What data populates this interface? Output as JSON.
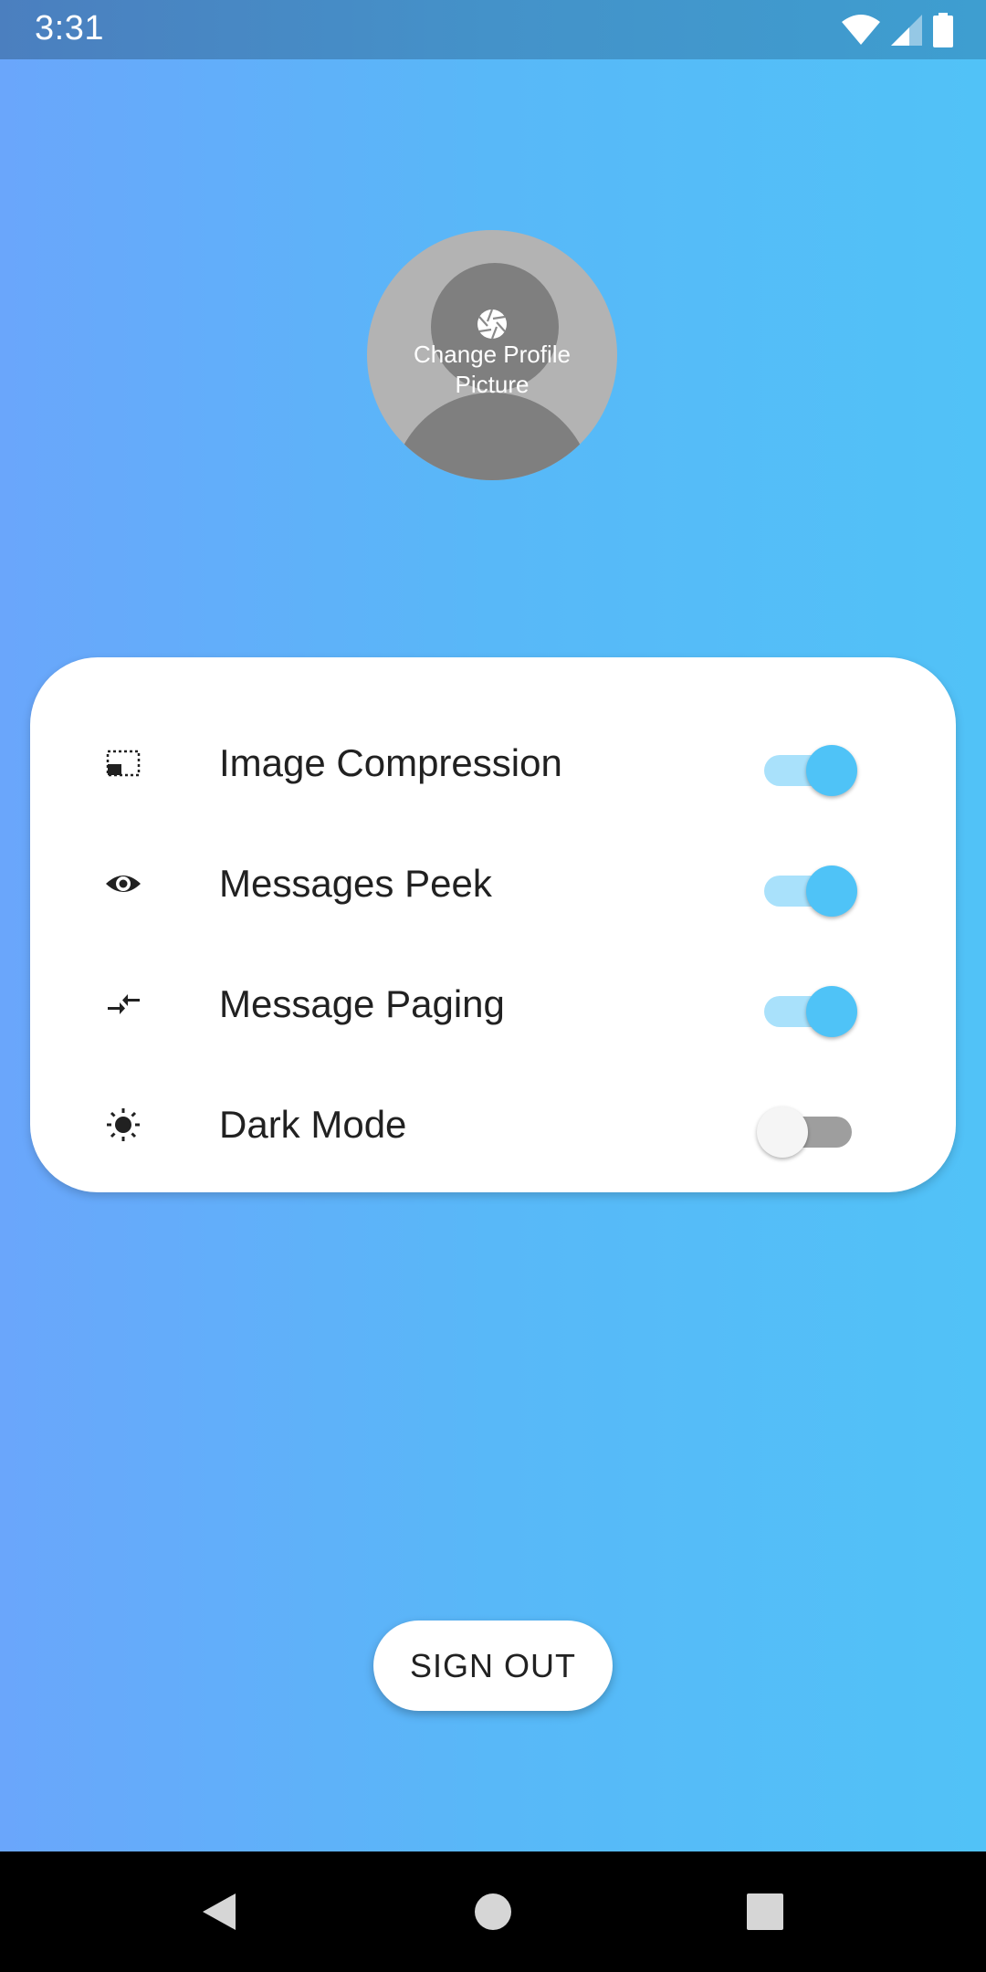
{
  "status_bar": {
    "time": "3:31",
    "icons": [
      "wifi-icon",
      "cellular-signal-icon",
      "battery-icon"
    ]
  },
  "profile": {
    "change_picture_label": "Change Profile\nPicture",
    "icon": "camera-shutter-icon"
  },
  "settings": [
    {
      "label": "Image Compression",
      "icon": "picture-in-picture-icon",
      "enabled": true
    },
    {
      "label": "Messages Peek",
      "icon": "eye-icon",
      "enabled": true
    },
    {
      "label": "Message Paging",
      "icon": "compare-arrows-icon",
      "enabled": true
    },
    {
      "label": "Dark Mode",
      "icon": "brightness-icon",
      "enabled": false
    }
  ],
  "sign_out_label": "SIGN OUT",
  "colors": {
    "accent": "#4fc3f7",
    "gradient_start": "#6aa6fb",
    "gradient_end": "#51c2f7"
  },
  "nav_bar": {
    "buttons": [
      "back-icon",
      "home-icon",
      "recents-icon"
    ]
  }
}
